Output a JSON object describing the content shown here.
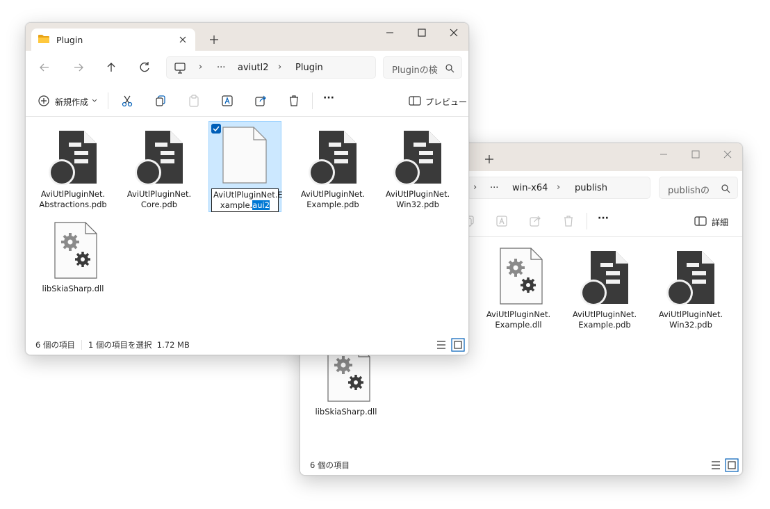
{
  "back_window": {
    "breadcrumb": {
      "more": "···",
      "crumb1": "win-x64",
      "crumb2": "publish",
      "sep": "›"
    },
    "search_placeholder": "publishの",
    "commands": {
      "more": "···",
      "details_label": "詳細"
    },
    "items": [
      {
        "label": "AviUtlPluginNet.\nExample.dll",
        "icon": "dll-gear-icon"
      },
      {
        "label": "AviUtlPluginNet.\nExample.pdb",
        "icon": "pdb-icon"
      },
      {
        "label": "AviUtlPluginNet.\nWin32.pdb",
        "icon": "pdb-icon"
      },
      {
        "label": "libSkiaSharp.dll",
        "icon": "dll-gear-icon"
      }
    ],
    "status": {
      "count": "6 個の項目"
    }
  },
  "front_window": {
    "tab_title": "Plugin",
    "breadcrumb": {
      "more": "···",
      "crumb1": "aviutl2",
      "crumb2": "Plugin",
      "sep": "›"
    },
    "search_placeholder": "Pluginの検",
    "commands": {
      "new_label": "新規作成",
      "more": "···",
      "preview_label": "プレビュー"
    },
    "items": [
      {
        "label": "AviUtlPluginNet.\nAbstractions.pdb",
        "icon": "pdb-icon"
      },
      {
        "label": "AviUtlPluginNet.\nCore.pdb",
        "icon": "pdb-icon"
      },
      {
        "label_plain": "AviUtlPluginNet.E",
        "label_plain2": "xample.",
        "label_selected": "aui2",
        "icon": "blank-file-icon",
        "selected": true
      },
      {
        "label": "AviUtlPluginNet.\nExample.pdb",
        "icon": "pdb-icon"
      },
      {
        "label": "AviUtlPluginNet.\nWin32.pdb",
        "icon": "pdb-icon"
      },
      {
        "label": "libSkiaSharp.dll",
        "icon": "dll-gear-icon"
      }
    ],
    "status": {
      "count": "6 個の項目",
      "selection": "1 個の項目を選択  1.72 MB"
    }
  },
  "colors": {
    "accent": "#005fb8",
    "selection_bg": "#cce8ff",
    "titlebar": "#ebe6e1",
    "rename_highlight": "#0078d4"
  }
}
